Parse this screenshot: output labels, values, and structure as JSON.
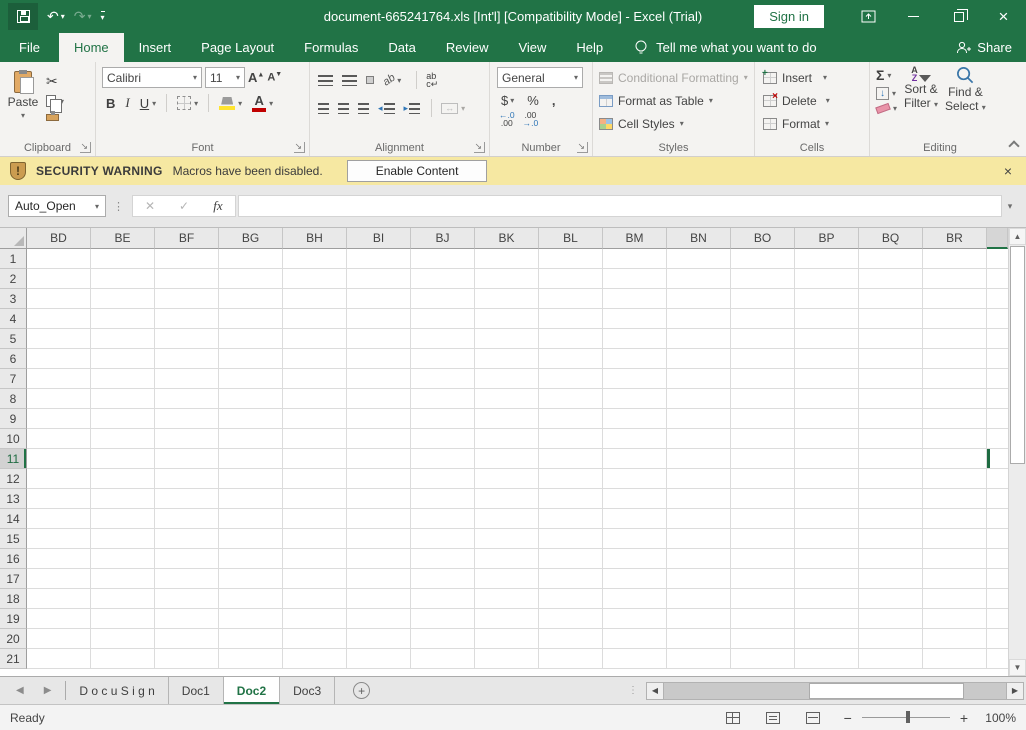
{
  "titlebar": {
    "title": "document-665241764.xls  [Int'l]  [Compatibility Mode]  -  Excel (Trial)",
    "sign_in_label": "Sign in"
  },
  "ribbon_tabs": {
    "items": [
      "File",
      "Home",
      "Insert",
      "Page Layout",
      "Formulas",
      "Data",
      "Review",
      "View",
      "Help"
    ],
    "active": "Home",
    "tell_me": "Tell me what you want to do",
    "share_label": "Share"
  },
  "ribbon": {
    "clipboard": {
      "label": "Clipboard",
      "paste_label": "Paste"
    },
    "font": {
      "label": "Font",
      "family": "Calibri",
      "size": "11",
      "bold": "B",
      "italic": "I",
      "underline": "U"
    },
    "alignment": {
      "label": "Alignment",
      "orientation_text": "ab",
      "wrap_top": "ab",
      "wrap_bottom": "c"
    },
    "number": {
      "label": "Number",
      "format_value": "General",
      "currency": "$",
      "percent": "%",
      "comma": ",",
      "inc_dec_top": "←.0",
      "inc_dec_bottom": ".00",
      "dec_dec_top": ".00",
      "dec_dec_bottom": "→.0"
    },
    "styles": {
      "label": "Styles",
      "conditional_formatting": "Conditional Formatting",
      "format_as_table": "Format as Table",
      "cell_styles": "Cell Styles"
    },
    "cells": {
      "label": "Cells",
      "insert": "Insert",
      "delete": "Delete",
      "format": "Format"
    },
    "editing": {
      "label": "Editing",
      "autosum_symbol": "Σ",
      "sort_a": "A",
      "sort_z": "Z",
      "sort_filter_line1": "Sort &",
      "sort_filter_line2": "Filter",
      "find_select_line1": "Find &",
      "find_select_line2": "Select"
    }
  },
  "security_bar": {
    "warning_label": "SECURITY WARNING",
    "message": "Macros have been disabled.",
    "enable_button_label": "Enable Content"
  },
  "formula_bar": {
    "name_box_value": "Auto_Open",
    "fx_label": "fx",
    "formula_value": ""
  },
  "grid": {
    "columns": [
      "BD",
      "BE",
      "BF",
      "BG",
      "BH",
      "BI",
      "BJ",
      "BK",
      "BL",
      "BM",
      "BN",
      "BO",
      "BP",
      "BQ",
      "BR"
    ],
    "rows": [
      "1",
      "2",
      "3",
      "4",
      "5",
      "6",
      "7",
      "8",
      "9",
      "10",
      "11",
      "12",
      "13",
      "14",
      "15",
      "16",
      "17",
      "18",
      "19",
      "20",
      "21"
    ],
    "active_row": "11"
  },
  "sheet_tabs": {
    "tabs": [
      {
        "label": "D o c u S i g n",
        "active": false
      },
      {
        "label": "Doc1",
        "active": false
      },
      {
        "label": "Doc2",
        "active": true
      },
      {
        "label": "Doc3",
        "active": false
      }
    ],
    "add_label": "+"
  },
  "status_bar": {
    "mode": "Ready",
    "zoom_level": "100%"
  },
  "colors": {
    "accent_green": "#217346",
    "warning_bg": "#f6e8a2",
    "font_color_red": "#c00000",
    "fill_color_yellow": "#ffe430"
  }
}
